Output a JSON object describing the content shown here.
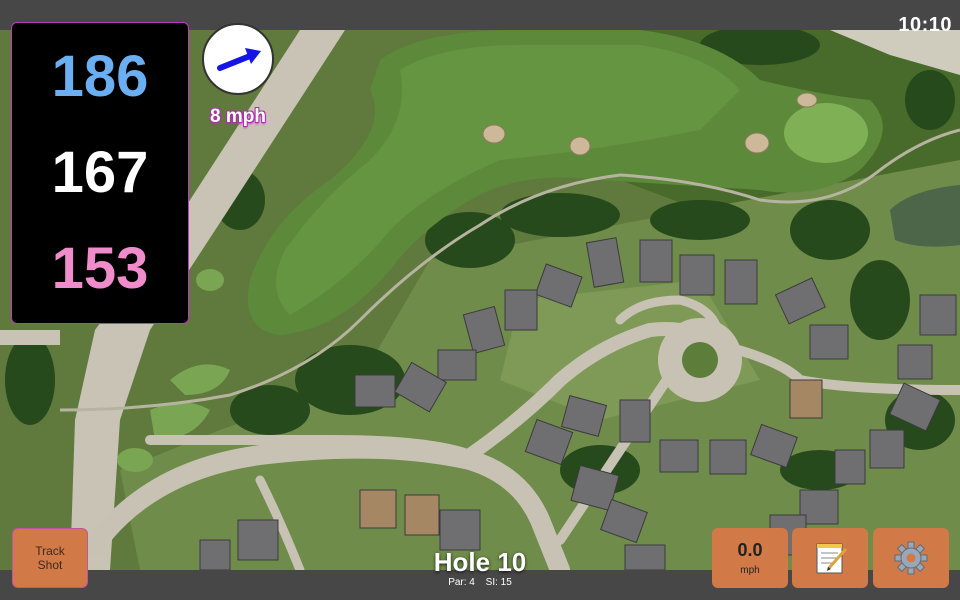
{
  "status": {
    "time": "10:10"
  },
  "distances": {
    "back": "186",
    "middle": "167",
    "front": "153"
  },
  "wind": {
    "speed_label": "8 mph"
  },
  "hole": {
    "title": "Hole 10",
    "par_label": "Par: 4",
    "si_label": "SI: 15"
  },
  "buttons": {
    "track_shot_line1": "Track",
    "track_shot_line2": "Shot",
    "speed_value": "0.0",
    "speed_unit": "mph"
  },
  "icons": {
    "wind": "arrow-icon",
    "notes": "notepad-icon",
    "settings": "gear-icon"
  },
  "colors": {
    "back_distance": "#6aaff2",
    "middle_distance": "#ffffff",
    "front_distance": "#f08ccb",
    "button": "#d17a48",
    "wind_arrow": "#1414e6"
  }
}
